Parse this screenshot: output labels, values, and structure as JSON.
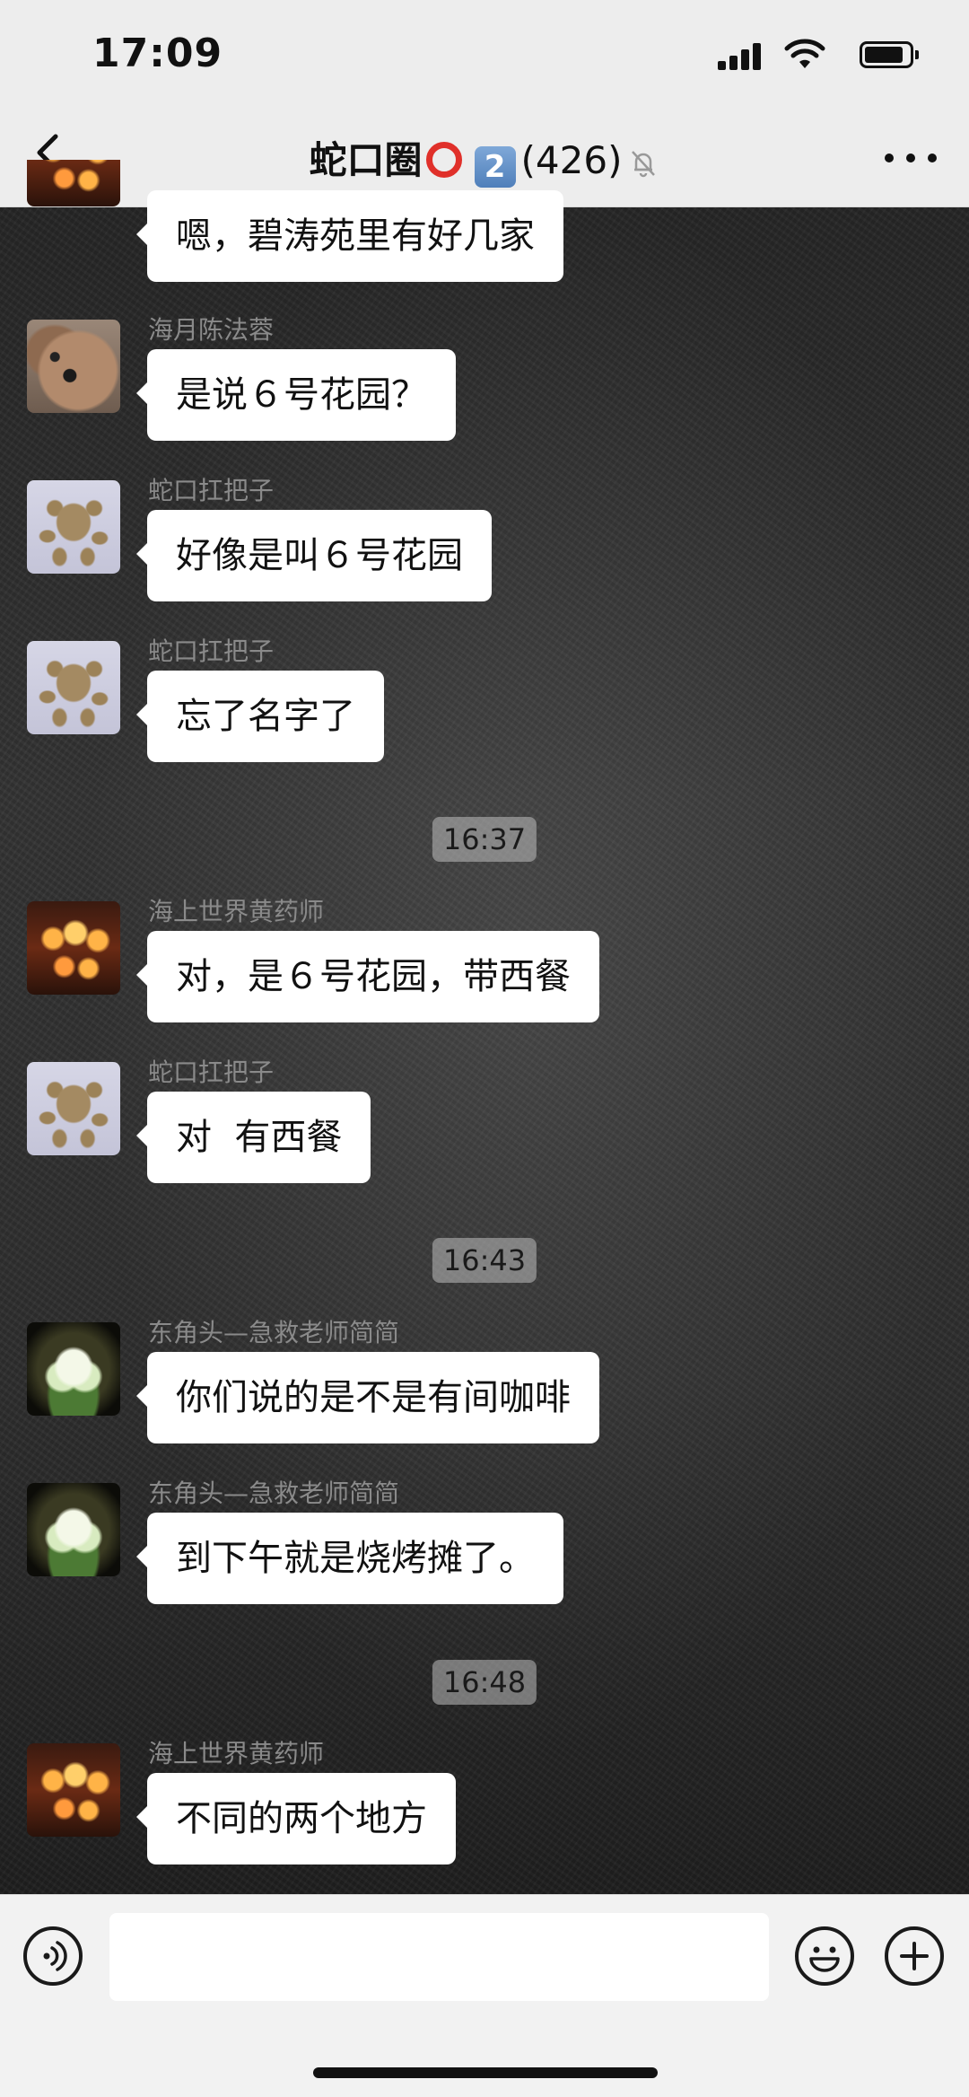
{
  "status_bar": {
    "time": "17:09"
  },
  "nav": {
    "title_name": "蛇口圈",
    "title_number": "2",
    "title_count": "(426)"
  },
  "messages": [
    {
      "sender": "",
      "avatar": "lantern",
      "text": "嗯，碧涛苑里有好几家"
    },
    {
      "sender": "海月陈法蓉",
      "avatar": "dog",
      "text": "是说６号花园？"
    },
    {
      "sender": "蛇口扛把子",
      "avatar": "spider",
      "text": "好像是叫６号花园"
    },
    {
      "sender": "蛇口扛把子",
      "avatar": "spider",
      "text": "忘了名字了"
    },
    {
      "sender": "海上世界黄药师",
      "avatar": "lantern",
      "text": "对，是６号花园，带西餐"
    },
    {
      "sender": "蛇口扛把子",
      "avatar": "spider",
      "text": "对  有西餐"
    },
    {
      "sender": "东角头—急救老师简简",
      "avatar": "lotus",
      "text": "你们说的是不是有间咖啡"
    },
    {
      "sender": "东角头—急救老师简简",
      "avatar": "lotus",
      "text": "到下午就是烧烤摊了。"
    },
    {
      "sender": "海上世界黄药师",
      "avatar": "lantern",
      "text": "不同的两个地方"
    }
  ],
  "timestamps": [
    "16:37",
    "16:43",
    "16:48"
  ],
  "input": {
    "value": "",
    "placeholder": ""
  },
  "colors": {
    "bubble": "#ffffff",
    "wallpaper": "#2b2b2b",
    "bar": "#ededed"
  }
}
